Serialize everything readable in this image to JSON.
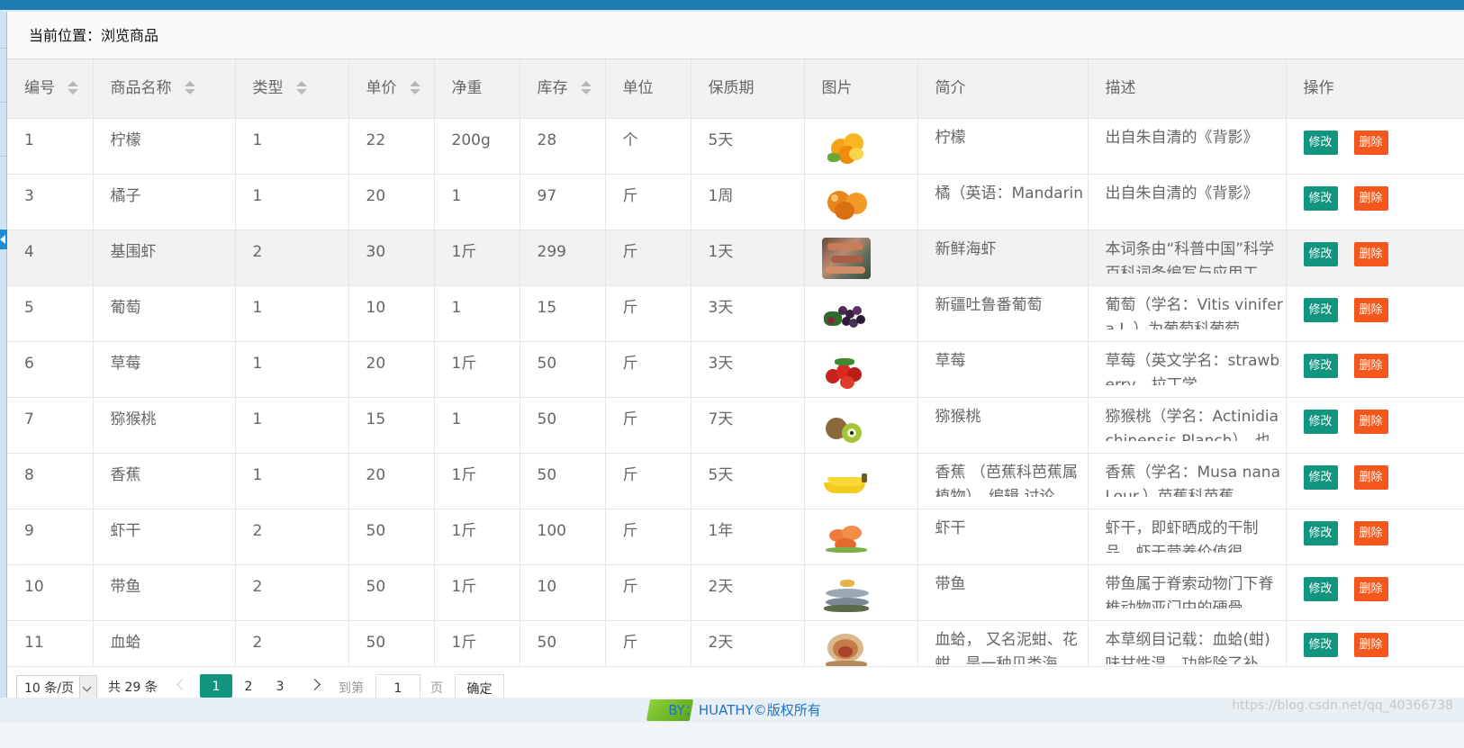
{
  "breadcrumb": {
    "label": "当前位置：浏览商品"
  },
  "table": {
    "headers": [
      {
        "label": "编号",
        "sortable": true
      },
      {
        "label": "商品名称",
        "sortable": true
      },
      {
        "label": "类型",
        "sortable": true
      },
      {
        "label": "单价",
        "sortable": true
      },
      {
        "label": "净重",
        "sortable": false
      },
      {
        "label": "库存",
        "sortable": true
      },
      {
        "label": "单位",
        "sortable": false
      },
      {
        "label": "保质期",
        "sortable": false
      },
      {
        "label": "图片",
        "sortable": false
      },
      {
        "label": "简介",
        "sortable": false
      },
      {
        "label": "描述",
        "sortable": false
      },
      {
        "label": "操作",
        "sortable": false
      }
    ],
    "edit_label": "修改",
    "delete_label": "删除",
    "rows": [
      {
        "id": "1",
        "name": "柠檬",
        "type": "1",
        "price": "22",
        "weight": "200g",
        "stock": "28",
        "unit": "个",
        "shelf_life": "5天",
        "image": "lemon-image",
        "summary": "柠檬",
        "description": "出自朱自清的《背影》"
      },
      {
        "id": "3",
        "name": "橘子",
        "type": "1",
        "price": "20",
        "weight": "1",
        "stock": "97",
        "unit": "斤",
        "shelf_life": "1周",
        "image": "orange-image",
        "summary": "橘（英语：Mandarin",
        "description": "出自朱自清的《背影》"
      },
      {
        "id": "4",
        "name": "基围虾",
        "type": "2",
        "price": "30",
        "weight": "1斤",
        "stock": "299",
        "unit": "斤",
        "shelf_life": "1天",
        "image": "shrimp-image",
        "summary": "新鲜海虾",
        "description": "本词条由“科普中国”科学百科词条编写与应用工"
      },
      {
        "id": "5",
        "name": "葡萄",
        "type": "1",
        "price": "10",
        "weight": "1",
        "stock": "15",
        "unit": "斤",
        "shelf_life": "3天",
        "image": "grape-image",
        "summary": "新疆吐鲁番葡萄",
        "description": "葡萄（学名：Vitis vinifera L.）为葡萄科葡萄"
      },
      {
        "id": "6",
        "name": "草莓",
        "type": "1",
        "price": "20",
        "weight": "1斤",
        "stock": "50",
        "unit": "斤",
        "shelf_life": "3天",
        "image": "strawberry-image",
        "summary": "草莓",
        "description": "草莓（英文学名：strawberry，拉丁学"
      },
      {
        "id": "7",
        "name": "猕猴桃",
        "type": "1",
        "price": "15",
        "weight": "1",
        "stock": "50",
        "unit": "斤",
        "shelf_life": "7天",
        "image": "kiwi-image",
        "summary": "猕猴桃",
        "description": "猕猴桃（学名：Actinidia chinensis Planch），也"
      },
      {
        "id": "8",
        "name": "香蕉",
        "type": "1",
        "price": "20",
        "weight": "1斤",
        "stock": "50",
        "unit": "斤",
        "shelf_life": "5天",
        "image": "banana-image",
        "summary": "香蕉 （芭蕉科芭蕉属植物），编辑 讨论",
        "description": "香蕉（学名：Musa nana Lour.）芭蕉科芭蕉"
      },
      {
        "id": "9",
        "name": "虾干",
        "type": "2",
        "price": "50",
        "weight": "1斤",
        "stock": "100",
        "unit": "斤",
        "shelf_life": "1年",
        "image": "dried-shrimp-image",
        "summary": "虾干",
        "description": "虾干，即虾晒成的干制品。虾干营养价值很"
      },
      {
        "id": "10",
        "name": "带鱼",
        "type": "2",
        "price": "50",
        "weight": "1斤",
        "stock": "10",
        "unit": "斤",
        "shelf_life": "2天",
        "image": "hairtail-image",
        "summary": "带鱼",
        "description": "带鱼属于脊索动物门下脊椎动物亚门中的硬骨"
      },
      {
        "id": "11",
        "name": "血蛤",
        "type": "2",
        "price": "50",
        "weight": "1斤",
        "stock": "50",
        "unit": "斤",
        "shelf_life": "2天",
        "image": "blood-clam-image",
        "summary": "血蛤， 又名泥蚶、花蚶，是一种贝类海",
        "description": "本草纲目记载：血蛤(蚶)味甘性温，功能除了补"
      }
    ]
  },
  "pager": {
    "page_size": "10 条/页",
    "total": "共 29 条",
    "pages": [
      "1",
      "2",
      "3"
    ],
    "current_page": "1",
    "goto_label": "到第",
    "goto_value": "1",
    "page_unit": "页",
    "confirm_label": "确定"
  },
  "footer": {
    "text": "BY：HUATHY©版权所有"
  },
  "watermark": "https://blog.csdn.net/qq_40366738",
  "colors": {
    "accent": "#12957f",
    "danger": "#f5561c",
    "topbar": "#1c7bb0"
  }
}
